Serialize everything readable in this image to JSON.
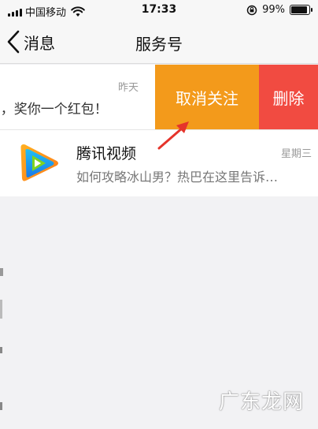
{
  "status_bar": {
    "carrier": "中国移动",
    "time": "17:33",
    "battery": "99%",
    "battery_level": 0.99
  },
  "nav": {
    "back_label": "消息",
    "title": "服务号"
  },
  "row1": {
    "date": "昨天",
    "preview": "l，奖你一个红包！",
    "unfollow_label": "取消关注",
    "delete_label": "删除"
  },
  "row2": {
    "name": "腾讯视频",
    "date": "星期三",
    "preview": "如何攻略冰山男？热巴在这里告诉…"
  },
  "watermark": "广东龙网",
  "colors": {
    "unfollow": "#f39a1b",
    "delete": "#f14b41",
    "arrow": "#e5342b"
  }
}
